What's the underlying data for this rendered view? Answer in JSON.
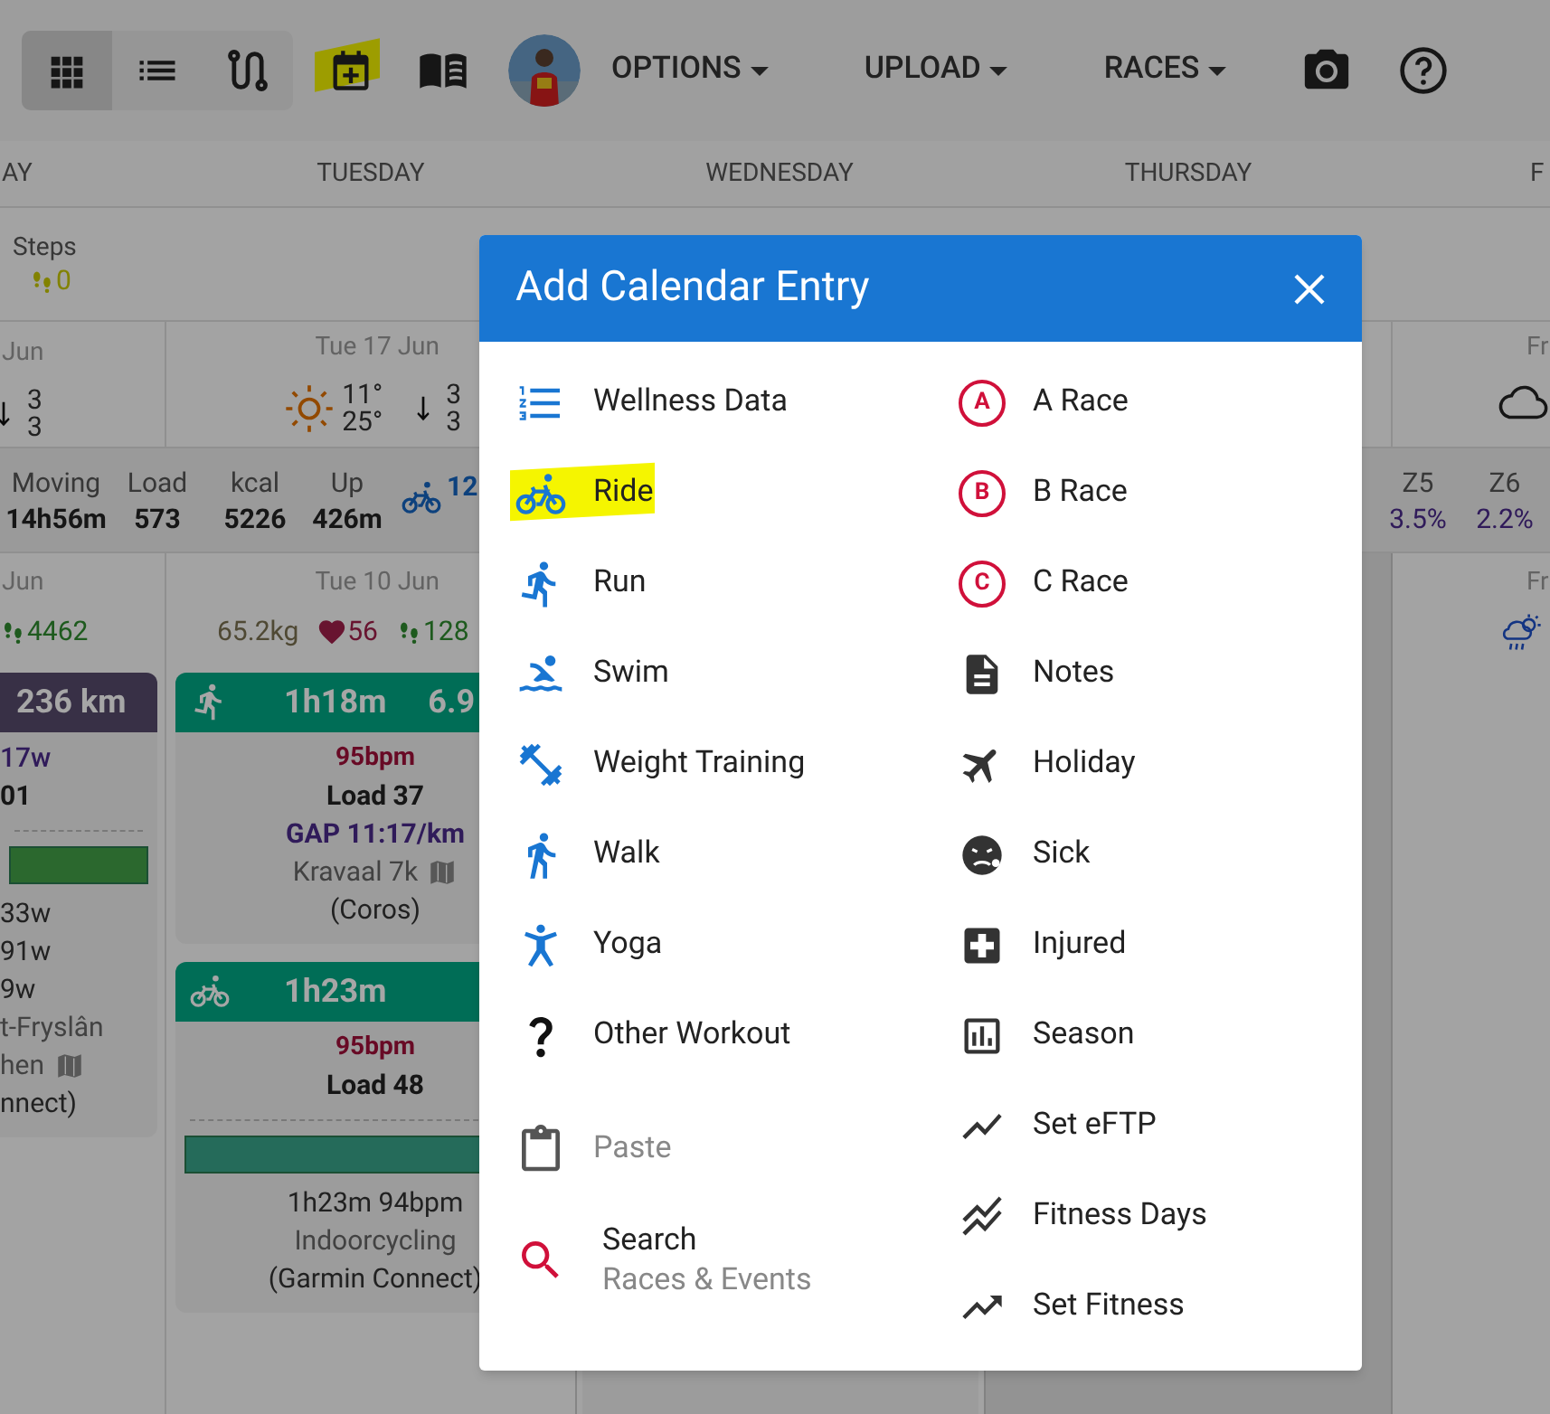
{
  "toolbar": {
    "view_buttons": [
      {
        "selected": true
      },
      {
        "selected": false
      },
      {
        "selected": false
      }
    ],
    "add_entry": {
      "highlighted": true
    },
    "menus": [
      "OPTIONS",
      "UPLOAD",
      "RACES"
    ]
  },
  "day_headers": [
    "AY",
    "TUESDAY",
    "WEDNESDAY",
    "THURSDAY",
    "F"
  ],
  "week_summary": {
    "label": "Steps",
    "steps": "0"
  },
  "weather_days": [
    {
      "date": "Jun",
      "wind": [
        "3",
        "3"
      ]
    },
    {
      "date": "Tue 17 Jun",
      "temps": [
        "11°",
        "25°"
      ],
      "wind": [
        "3",
        "3"
      ]
    },
    {
      "date": "Fr"
    }
  ],
  "week_stats": [
    {
      "label": "Moving",
      "value": "14h56m"
    },
    {
      "label": "Load",
      "value": "573"
    },
    {
      "label": "kcal",
      "value": "5226"
    },
    {
      "label": "Up",
      "value": "426m"
    }
  ],
  "ride_total": "12",
  "zones": [
    {
      "label": "Z5",
      "value": "3.5%"
    },
    {
      "label": "Z6",
      "value": "2.2%"
    }
  ],
  "days": [
    {
      "date": "Jun",
      "steps": "4462"
    },
    {
      "date": "Tue 10 Jun",
      "weight": "65.2kg",
      "resting_hr": "56",
      "steps": "128"
    },
    {
      "date": "Fr"
    }
  ],
  "monday_card": {
    "kind": "none",
    "header": [
      "236 km"
    ],
    "lines": [
      {
        "kind": "power",
        "text": "17w"
      },
      {
        "kind": "bold",
        "text": "01"
      },
      {
        "kind": "divider"
      },
      {
        "kind": "bar"
      },
      {
        "kind": "text",
        "text": "33w"
      },
      {
        "kind": "text",
        "text": "91w"
      },
      {
        "kind": "text",
        "text": "9w"
      },
      {
        "kind": "muted",
        "text": "t-Fryslân"
      },
      {
        "kind": "map",
        "text": "hen"
      },
      {
        "kind": "text",
        "text": "nnect)"
      }
    ]
  },
  "tuesday_cards": [
    {
      "kind": "run",
      "header": [
        "1h18m",
        "6.9"
      ],
      "lines": [
        {
          "kind": "hr",
          "text": "95bpm"
        },
        {
          "kind": "bold",
          "text": "Load 37"
        },
        {
          "kind": "pace",
          "text": "GAP 11:17/km"
        },
        {
          "kind": "map",
          "text": "Kravaal 7k"
        },
        {
          "kind": "text",
          "text": "(Coros)"
        }
      ]
    },
    {
      "kind": "ride",
      "header": [
        "1h23m"
      ],
      "lines": [
        {
          "kind": "hr",
          "text": "95bpm"
        },
        {
          "kind": "bold",
          "text": "Load 48"
        },
        {
          "kind": "divider"
        },
        {
          "kind": "bar"
        },
        {
          "kind": "text",
          "text": "1h23m 94bpm"
        },
        {
          "kind": "muted",
          "text": "Indoorcycling"
        },
        {
          "kind": "text",
          "text": "(Garmin Connect)"
        }
      ]
    }
  ],
  "dialog": {
    "title": "Add Calendar Entry",
    "left_items": [
      {
        "label": "Wellness Data",
        "highlighted": false,
        "disabled": false
      },
      {
        "label": "Ride",
        "highlighted": true,
        "disabled": false
      },
      {
        "label": "Run",
        "highlighted": false,
        "disabled": false
      },
      {
        "label": "Swim",
        "highlighted": false,
        "disabled": false
      },
      {
        "label": "Weight Training",
        "highlighted": false,
        "disabled": false
      },
      {
        "label": "Walk",
        "highlighted": false,
        "disabled": false
      },
      {
        "label": "Yoga",
        "highlighted": false,
        "disabled": false
      },
      {
        "label": "Other Workout",
        "highlighted": false,
        "disabled": false
      },
      {
        "label": "Paste",
        "highlighted": false,
        "disabled": true
      },
      {
        "label": "Search",
        "sublabel": "Races & Events",
        "highlighted": false,
        "disabled": false
      }
    ],
    "right_items": [
      {
        "label": "A Race",
        "badge": "A"
      },
      {
        "label": "B Race",
        "badge": "B"
      },
      {
        "label": "C Race",
        "badge": "C"
      },
      {
        "label": "Notes"
      },
      {
        "label": "Holiday"
      },
      {
        "label": "Sick"
      },
      {
        "label": "Injured"
      },
      {
        "label": "Season"
      },
      {
        "label": "Set eFTP"
      },
      {
        "label": "Fitness Days"
      },
      {
        "label": "Set Fitness"
      }
    ]
  }
}
